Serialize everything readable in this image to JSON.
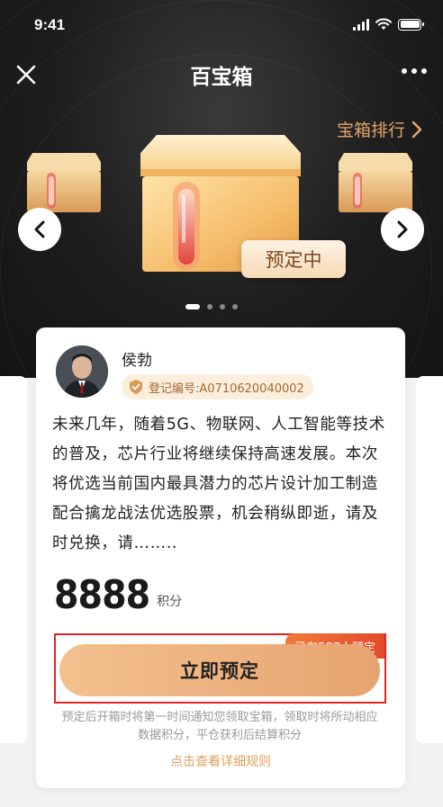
{
  "status_bar": {
    "time": "9:41"
  },
  "nav": {
    "title": "百宝箱"
  },
  "hero": {
    "rank_link": "宝箱排行",
    "status_tag": "预定中"
  },
  "card": {
    "author_name": "侯勃",
    "registration": "登记编号:A0710620040002",
    "description": "未来几年，随着5G、物联网、人工智能等技术的普及，芯片行业将继续保持高速发展。本次将优选当前国内最具潜力的芯片设计加工制造配合擒龙战法优选股票，机会稍纵即逝，请及时兑换，请……..",
    "points_value": "8888",
    "points_unit": "积分",
    "quota_badge": "已有587人预定",
    "reserve_button": "立即预定",
    "notice": "预定后开箱时将第一时间通知您领取宝箱，领取时将所动相应数据积分，平仓获利后结算积分",
    "rules_link": "点击查看详细规则"
  },
  "colors": {
    "accent": "#e3a46c",
    "button_gradient_start": "#f3c08e",
    "button_gradient_end": "#e6a470",
    "quota_red": "#e44a2a",
    "highlight_border": "#e02525"
  },
  "carousel": {
    "total": 4,
    "active_index": 0
  }
}
